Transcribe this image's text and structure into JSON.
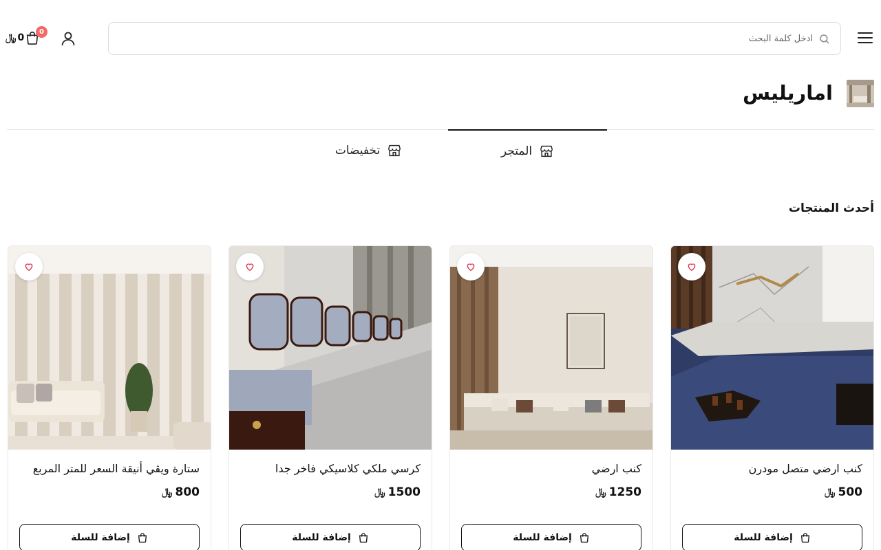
{
  "header": {
    "search_placeholder": "ادخل كلمة البحث",
    "cart_count": "0",
    "cart_total": "0",
    "currency_symbol": "﷼",
    "icons": {
      "menu": "hamburger-icon",
      "search": "search-icon",
      "user": "user-icon",
      "cart": "shopping-bag-icon"
    }
  },
  "store": {
    "name": "اماريليس"
  },
  "tabs": [
    {
      "label": "المتجر",
      "active": true,
      "icon": "storefront-icon"
    },
    {
      "label": "تخفيضات",
      "active": false,
      "icon": "storefront-icon"
    }
  ],
  "section": {
    "title": "أحدث المنتجات"
  },
  "products": [
    {
      "title": "كنب ارضي متصل مودرن",
      "price": "500",
      "add_to_cart": "إضافة للسلة"
    },
    {
      "title": "كنب ارضي",
      "price": "1250",
      "add_to_cart": "إضافة للسلة"
    },
    {
      "title": "كرسي ملكي كلاسيكي فاخر جدا",
      "price": "1500",
      "add_to_cart": "إضافة للسلة"
    },
    {
      "title": "ستارة ويڤي أنيقة السعر للمتر المربع",
      "price": "800",
      "add_to_cart": "إضافة للسلة"
    }
  ],
  "colors": {
    "badge": "#f06a6a",
    "text": "#111111",
    "border": "#e6e6e6"
  }
}
